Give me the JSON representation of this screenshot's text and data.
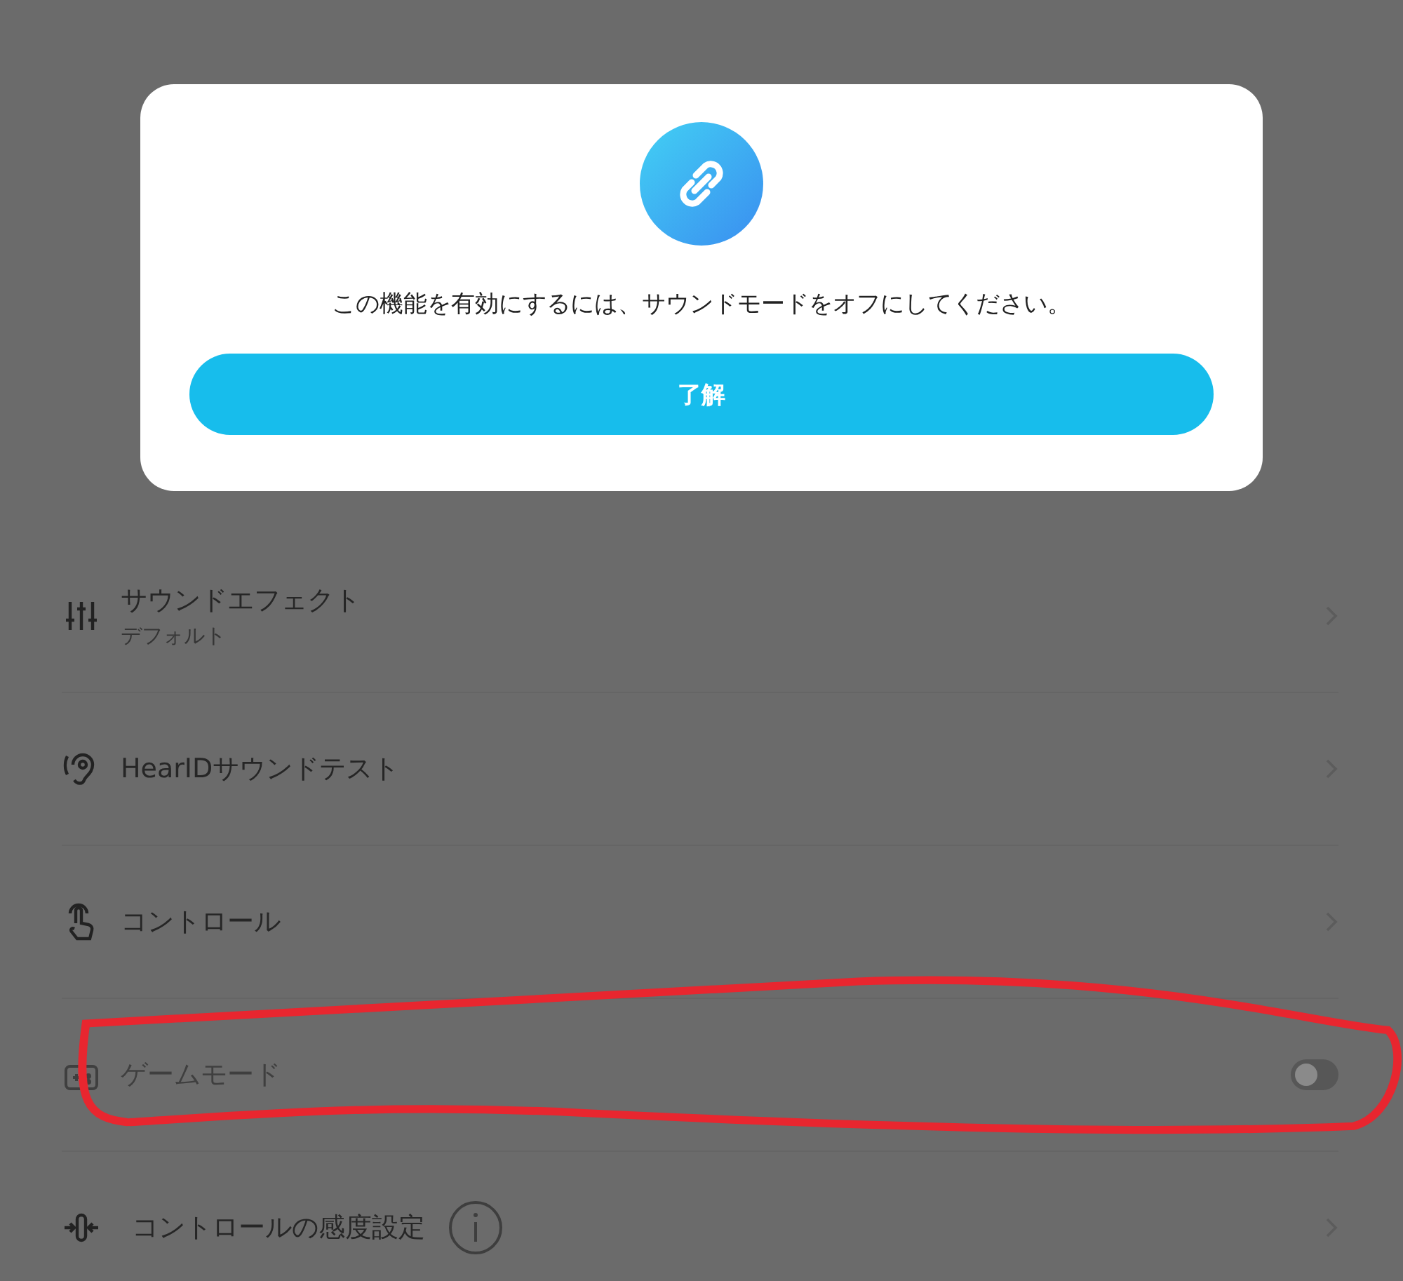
{
  "settings": [
    {
      "kind": "effect",
      "label": "サウンドエフェクト",
      "subtitle": "デフォルト",
      "disabled": false,
      "chevron": true
    },
    {
      "kind": "ear",
      "label": "HearIDサウンドテスト",
      "disabled": false,
      "chevron": true
    },
    {
      "kind": "touch",
      "label": "コントロール",
      "disabled": false,
      "chevron": true
    },
    {
      "kind": "game",
      "label": "ゲームモード",
      "disabled": true,
      "chevron": false,
      "toggle": {
        "on": false
      },
      "highlighted": true
    },
    {
      "kind": "sensitivity",
      "label": "コントロールの感度設定",
      "info": true,
      "disabled": false,
      "chevron": true
    }
  ],
  "dialog": {
    "message": "この機能を有効にするには、サウンドモードをオフにしてください。",
    "button": "了解"
  }
}
